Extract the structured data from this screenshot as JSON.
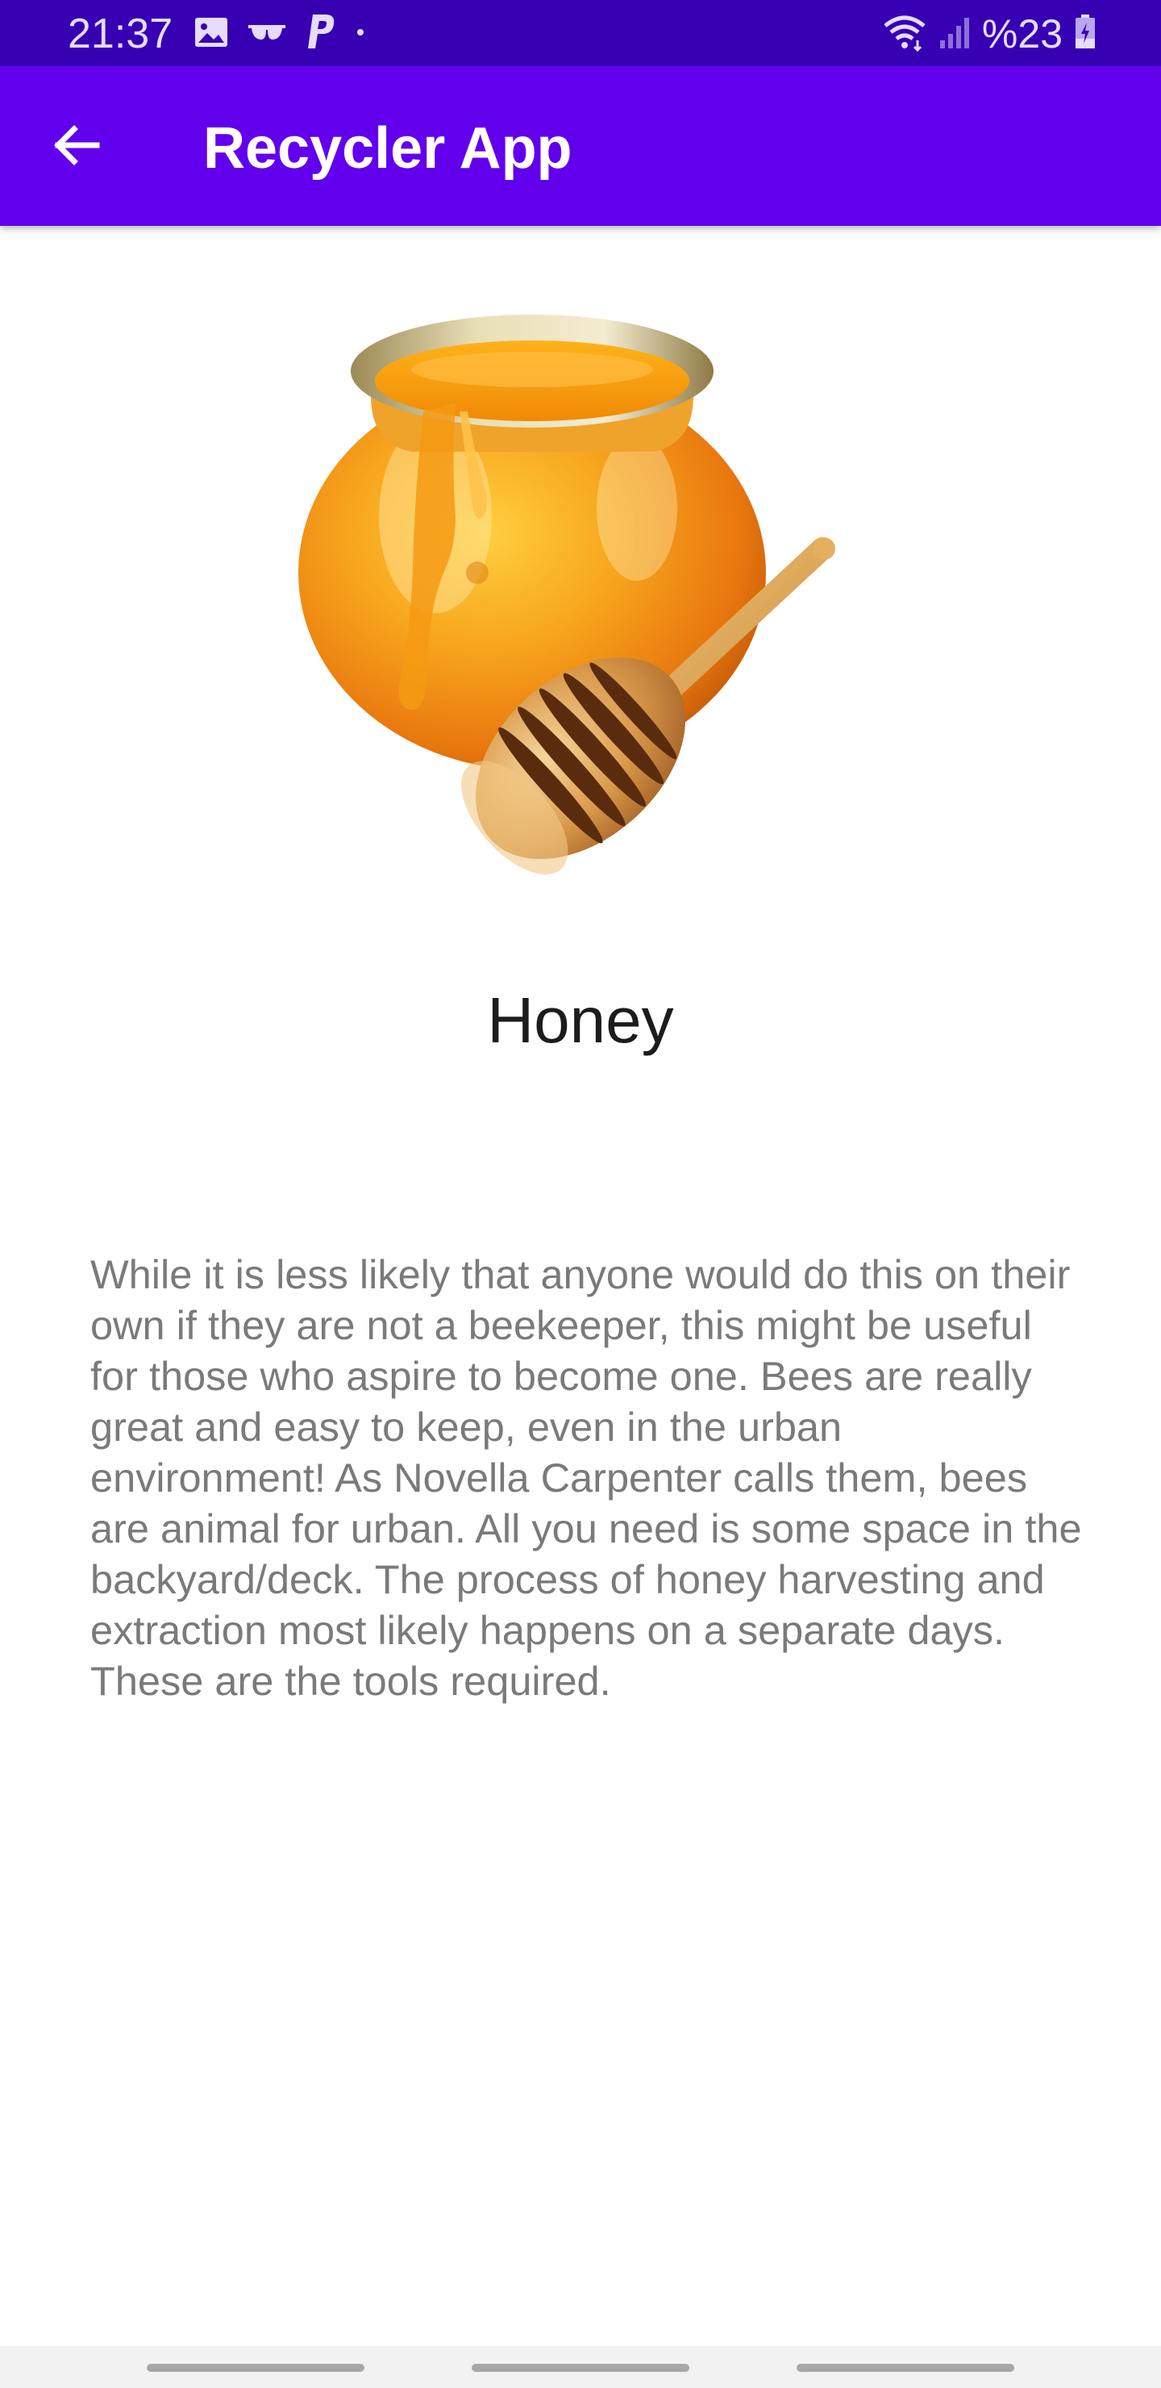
{
  "status_bar": {
    "time": "21:37",
    "battery_text": "%23",
    "icons_left": [
      "image-icon",
      "glasses-icon",
      "paypal-icon",
      "dot-icon"
    ],
    "icons_right": [
      "wifi-icon",
      "signal-icon",
      "battery-icon"
    ]
  },
  "app_bar": {
    "title": "Recycler App",
    "back_icon": "arrow-back-icon",
    "color": "#6200EE",
    "status_color": "#3700B3"
  },
  "detail": {
    "image": "honey-pot-image",
    "title": "Honey",
    "description": "While it is less likely that anyone would do this on their own if they are not a beekeeper, this might be useful for those who aspire to become one. Bees are really great and easy to keep, even in the urban environment! As Novella Carpenter calls them, bees are animal for urban. All you need is some space in the backyard/deck. The process of honey harvesting and extraction most likely happens on a separate days. These are the tools required."
  }
}
